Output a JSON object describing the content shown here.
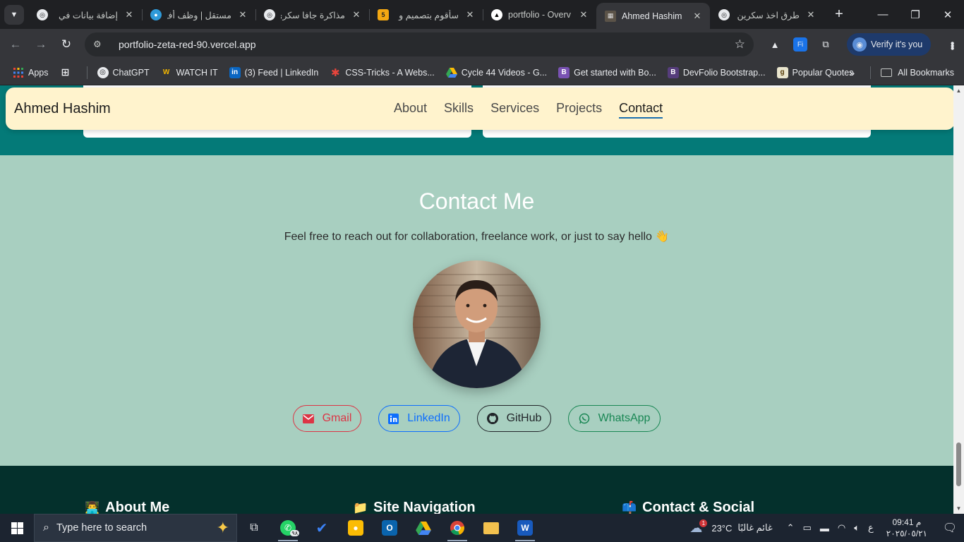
{
  "browser": {
    "tabs": [
      {
        "title": "إضافة بيانات في",
        "favicon": "openai-icon",
        "active": false
      },
      {
        "title": "مستقل | وظف أف",
        "favicon": "mostaql-icon",
        "active": false
      },
      {
        "title": "مذاكرة جافا سكري",
        "favicon": "openai-icon",
        "active": false
      },
      {
        "title": "سأقوم بتصميم و",
        "favicon": "khamsat-icon",
        "active": false
      },
      {
        "title": "portfolio - Overv",
        "favicon": "vercel-icon",
        "active": false
      },
      {
        "title": "Ahmed Hashim",
        "favicon": "site-icon",
        "active": true
      },
      {
        "title": "طرق اخذ سكرين",
        "favicon": "openai-icon",
        "active": false
      }
    ],
    "url": "portfolio-zeta-red-90.vercel.app",
    "verify_label": "Verify it's you",
    "bookmarks": [
      {
        "label": "Apps",
        "icon": "apps-grid-icon"
      },
      {
        "label": "",
        "icon": "tab-groups-icon"
      },
      {
        "label": "ChatGPT",
        "icon": "openai-icon"
      },
      {
        "label": "WATCH IT",
        "icon": "watchit-icon"
      },
      {
        "label": "(3) Feed | LinkedIn",
        "icon": "linkedin-icon"
      },
      {
        "label": "CSS-Tricks - A Webs...",
        "icon": "css-tricks-icon"
      },
      {
        "label": "Cycle 44 Videos - G...",
        "icon": "google-drive-icon"
      },
      {
        "label": "Get started with Bo...",
        "icon": "bootstrap-icon"
      },
      {
        "label": "DevFolio Bootstrap...",
        "icon": "bootstrap-icon"
      },
      {
        "label": "Popular Quotes",
        "icon": "goodreads-icon"
      }
    ],
    "all_bookmarks": "All Bookmarks"
  },
  "page": {
    "brand": "Ahmed Hashim",
    "nav": [
      "About",
      "Skills",
      "Services",
      "Projects",
      "Contact"
    ],
    "current_nav": "Contact",
    "contact": {
      "title": "Contact Me",
      "subtitle": "Feel free to reach out for collaboration, freelance work, or just to say hello 👋"
    },
    "social": [
      {
        "label": "Gmail",
        "icon": "envelope-icon",
        "color": "#dc3545"
      },
      {
        "label": "LinkedIn",
        "icon": "linkedin-icon",
        "color": "#0d6efd"
      },
      {
        "label": "GitHub",
        "icon": "github-icon",
        "color": "#212529"
      },
      {
        "label": "WhatsApp",
        "icon": "whatsapp-icon",
        "color": "#198754"
      }
    ],
    "footer": [
      {
        "emoji": "👨‍💻",
        "title": "About Me"
      },
      {
        "emoji": "📁",
        "title": "Site Navigation"
      },
      {
        "emoji": "📫",
        "title": "Contact & Social"
      }
    ]
  },
  "taskbar": {
    "search_placeholder": "Type here to search",
    "temperature": "23°C",
    "weather_text": "غائم غالبًا",
    "time": "09:41 م",
    "date": "٢٠٢٥/٠٥/٢١",
    "lang": "ع",
    "weather_badge": "1",
    "whatsapp_badge": "٩٨"
  },
  "colors": {
    "page_bg": "#a8cfc0",
    "teal_band": "#047a78",
    "nav_bg": "#fff3cd",
    "footer_bg": "#04302c"
  }
}
